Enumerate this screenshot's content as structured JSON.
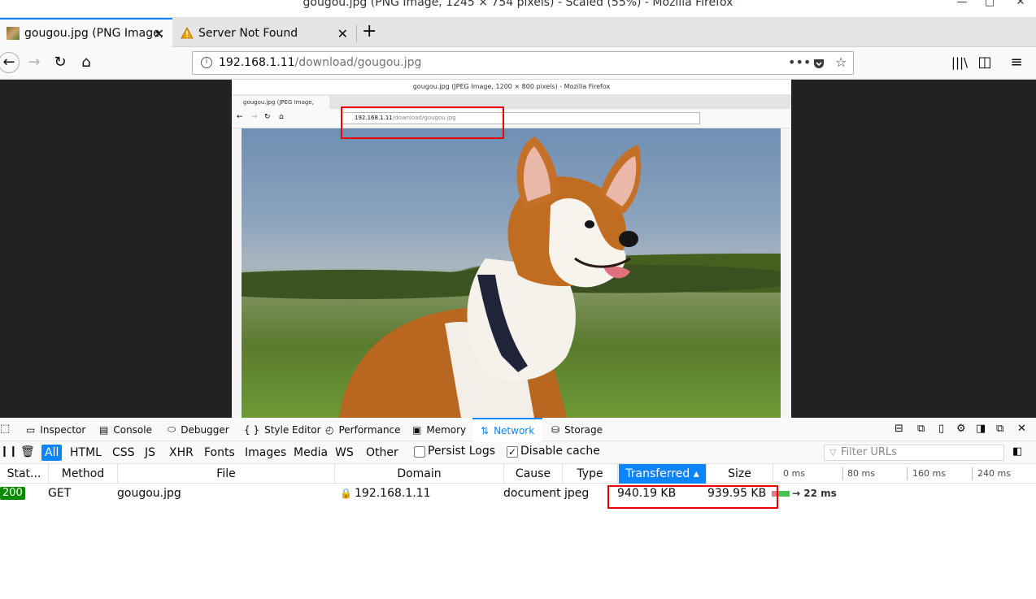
{
  "window": {
    "title": "gougou.jpg (PNG Image, 1245 × 754 pixels) - Scaled (55%) - Mozilla Firefox"
  },
  "tabs": [
    {
      "label": "gougou.jpg (PNG Image, ",
      "active": true
    },
    {
      "label": "Server Not Found",
      "active": false
    }
  ],
  "urlbar": {
    "host": "192.168.1.11",
    "path": "/download/gougou.jpg"
  },
  "inner_screenshot": {
    "title": "gougou.jpg (JPEG Image, 1200 × 800 pixels) - Mozilla Firefox",
    "tab_label": "gougou.jpg (JPEG Image, ",
    "url_host": "192.168.1.11",
    "url_path": "/download/gougou.jpg"
  },
  "devtools": {
    "tabs": [
      {
        "label": "Inspector",
        "icon": "inspector-icon"
      },
      {
        "label": "Console",
        "icon": "console-icon"
      },
      {
        "label": "Debugger",
        "icon": "debugger-icon"
      },
      {
        "label": "Style Editor",
        "icon": "style-editor-icon"
      },
      {
        "label": "Performance",
        "icon": "performance-icon"
      },
      {
        "label": "Memory",
        "icon": "memory-icon"
      },
      {
        "label": "Network",
        "icon": "network-icon",
        "active": true
      },
      {
        "label": "Storage",
        "icon": "storage-icon"
      }
    ],
    "filters": [
      "All",
      "HTML",
      "CSS",
      "JS",
      "XHR",
      "Fonts",
      "Images",
      "Media",
      "WS",
      "Other"
    ],
    "persist_logs": {
      "label": "Persist Logs",
      "checked": false
    },
    "disable_cache": {
      "label": "Disable cache",
      "checked": true
    },
    "filter_urls_placeholder": "Filter URLs",
    "columns": [
      "Stat...",
      "Method",
      "File",
      "Domain",
      "Cause",
      "Type",
      "Transferred ▴",
      "Size"
    ],
    "timeline_ticks": [
      "0 ms",
      "80 ms",
      "160 ms",
      "240 ms"
    ],
    "requests": [
      {
        "status": "200",
        "method": "GET",
        "file": "gougou.jpg",
        "domain": "192.168.1.11",
        "cause": "document",
        "type": "jpeg",
        "transferred": "940.19 KB",
        "size": "939.95 KB",
        "timing": "→ 22 ms"
      }
    ]
  },
  "colors": {
    "accent": "#0a84ff",
    "status_ok": "#058b00",
    "highlight": "#e00000"
  }
}
